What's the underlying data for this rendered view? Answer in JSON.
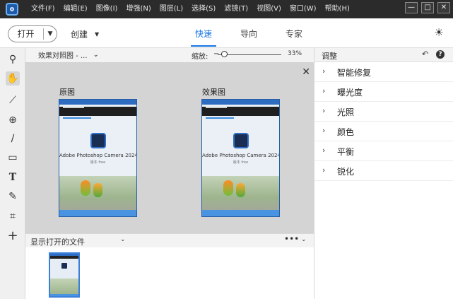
{
  "menu": [
    "文件(F)",
    "编辑(E)",
    "图像(I)",
    "增强(N)",
    "图层(L)",
    "选择(S)",
    "滤镜(T)",
    "视图(V)",
    "窗口(W)",
    "帮助(H)"
  ],
  "window_controls": {
    "minimize": "—",
    "maximize": "□",
    "close": "✕"
  },
  "toolbar": {
    "open_label": "打开",
    "create_label": "创建",
    "modes": [
      "快速",
      "导向",
      "专家"
    ],
    "active_mode": "快速"
  },
  "view": {
    "mode_select": "效果对照图 - ...",
    "zoom_label": "缩放:",
    "zoom_value": "33%",
    "zoom_fraction": 0.05
  },
  "canvas": {
    "before_label": "原图",
    "after_label": "效果图",
    "app_title_in_image": "Adobe Photoshop Camera 2024",
    "app_sub_in_image": "版本 free"
  },
  "files": {
    "label": "显示打开的文件"
  },
  "panel": {
    "title": "调整",
    "items": [
      "智能修复",
      "曝光度",
      "光照",
      "颜色",
      "平衡",
      "锐化"
    ]
  },
  "tools": [
    "zoom-icon",
    "hand-icon",
    "quick-selection-icon",
    "eye-icon",
    "brush-icon",
    "stamp-icon",
    "text-icon",
    "spot-heal-icon",
    "crop-icon",
    "move-icon"
  ],
  "colors": {
    "accent": "#1473e6",
    "titlebar": "#2b2b2b"
  }
}
